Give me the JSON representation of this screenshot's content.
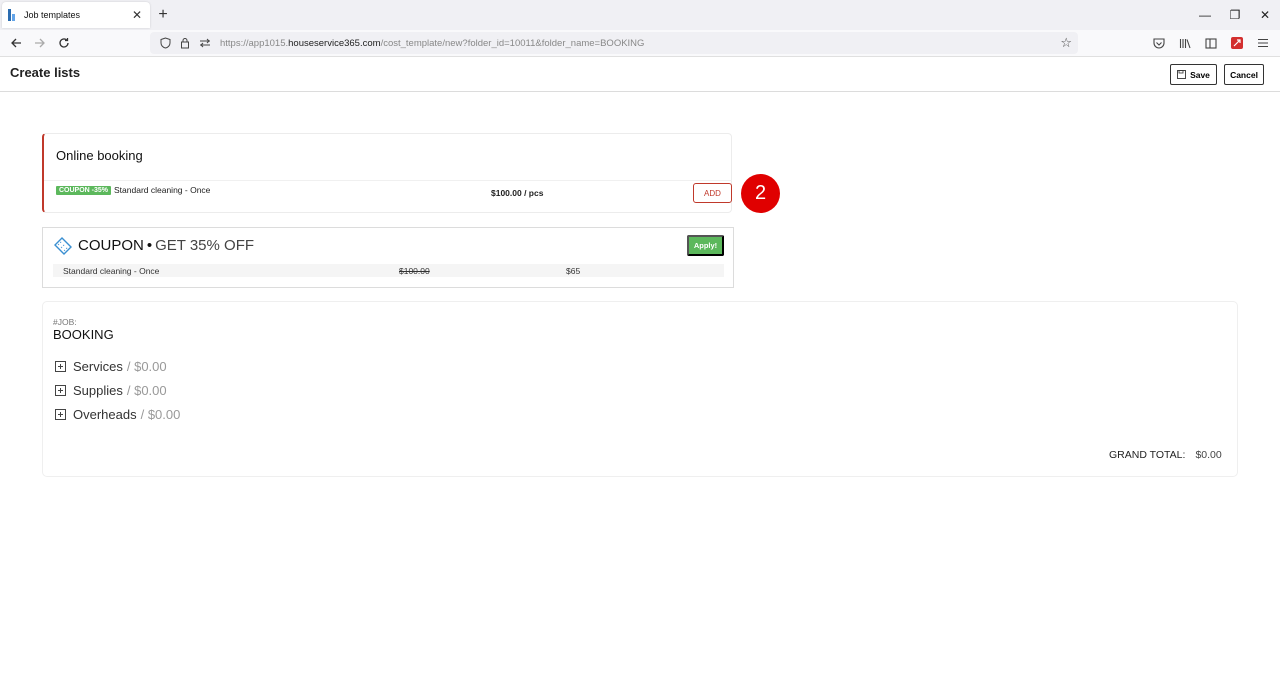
{
  "browser": {
    "tab_title": "Job templates",
    "tab_close": "✕",
    "new_tab": "+",
    "url_prefix": "https://app1015.",
    "url_domain": "houseservice365.com",
    "url_path": "/cost_template/new?folder_id=10011&folder_name=BOOKING",
    "window": {
      "minimize": "—",
      "restore": "❐",
      "close": "✕"
    }
  },
  "header": {
    "title": "Create lists",
    "save_label": "Save",
    "cancel_label": "Cancel"
  },
  "booking": {
    "title": "Online booking",
    "coupon_badge": "COUPON -35%",
    "service": "Standard cleaning - Once",
    "price": "$100.00 / pcs",
    "add_label": "ADD"
  },
  "step_marker": "2",
  "coupon": {
    "heading": "COUPON",
    "separator": "•",
    "offer": "GET 35% OFF",
    "apply_label": "Apply!",
    "row": {
      "service": "Standard cleaning - Once",
      "original_price": "$100.00",
      "discounted_price": "$65"
    },
    "icon_color": "#3a8fd1"
  },
  "job": {
    "label": "#JOB:",
    "name": "BOOKING",
    "sections": [
      {
        "name": "Services",
        "amount": "/ $0.00"
      },
      {
        "name": "Supplies",
        "amount": "/ $0.00"
      },
      {
        "name": "Overheads",
        "amount": "/ $0.00"
      }
    ],
    "grand_total_label": "GRAND TOTAL:",
    "grand_total_value": "$0.00"
  },
  "colors": {
    "accent_red": "#c0392b",
    "success_green": "#5cb85c",
    "marker_red": "#e00000"
  }
}
